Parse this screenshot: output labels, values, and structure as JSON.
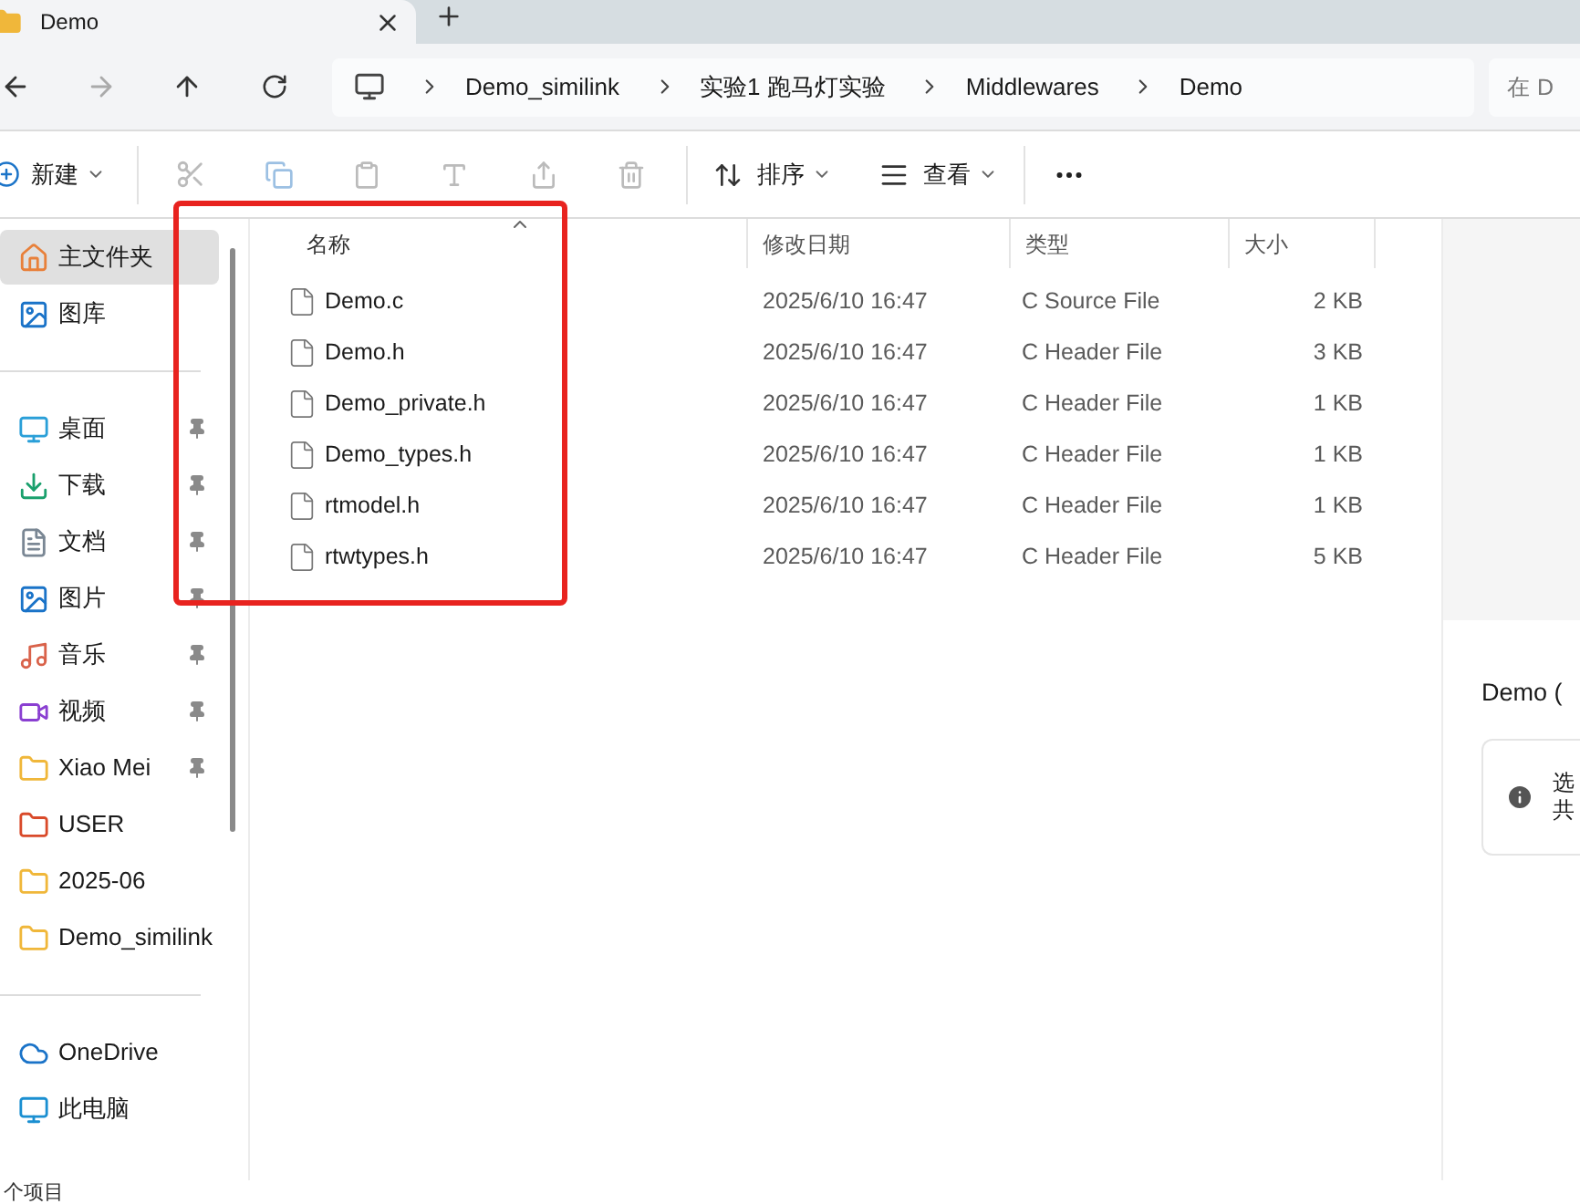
{
  "tab": {
    "title": "Demo"
  },
  "address": {
    "segments": [
      "Demo_similink",
      "实验1 跑马灯实验",
      "Middlewares",
      "Demo"
    ],
    "search_placeholder": "在 D"
  },
  "toolbar": {
    "new": "新建",
    "sort": "排序",
    "view": "查看"
  },
  "sidebar": {
    "groups": [
      {
        "items": [
          {
            "label": "主文件夹",
            "kind": "home",
            "pinned": false,
            "selected": true
          },
          {
            "label": "图库",
            "kind": "gallery",
            "pinned": false,
            "selected": false
          }
        ]
      },
      {
        "items": [
          {
            "label": "桌面",
            "kind": "desktop",
            "pinned": true,
            "selected": false
          },
          {
            "label": "下载",
            "kind": "download",
            "pinned": true,
            "selected": false
          },
          {
            "label": "文档",
            "kind": "document",
            "pinned": true,
            "selected": false
          },
          {
            "label": "图片",
            "kind": "picture",
            "pinned": true,
            "selected": false
          },
          {
            "label": "音乐",
            "kind": "music",
            "pinned": true,
            "selected": false
          },
          {
            "label": "视频",
            "kind": "video",
            "pinned": true,
            "selected": false
          },
          {
            "label": "Xiao Mei",
            "kind": "folder",
            "pinned": true,
            "selected": false
          },
          {
            "label": "USER",
            "kind": "folder-alert",
            "pinned": false,
            "selected": false
          },
          {
            "label": "2025-06",
            "kind": "folder",
            "pinned": false,
            "selected": false
          },
          {
            "label": "Demo_similink",
            "kind": "folder",
            "pinned": false,
            "selected": false
          }
        ]
      },
      {
        "items": [
          {
            "label": "OneDrive",
            "kind": "cloud",
            "pinned": false,
            "selected": false
          },
          {
            "label": "此电脑",
            "kind": "pc",
            "pinned": false,
            "selected": false
          }
        ]
      }
    ]
  },
  "table": {
    "columns": [
      {
        "label": "名称",
        "sorted": true
      },
      {
        "label": "修改日期",
        "sorted": false
      },
      {
        "label": "类型",
        "sorted": false
      },
      {
        "label": "大小",
        "sorted": false
      }
    ],
    "rows": [
      {
        "name": "Demo.c",
        "modified": "2025/6/10 16:47",
        "type": "C Source File",
        "size": "2 KB"
      },
      {
        "name": "Demo.h",
        "modified": "2025/6/10 16:47",
        "type": "C Header File",
        "size": "3 KB"
      },
      {
        "name": "Demo_private.h",
        "modified": "2025/6/10 16:47",
        "type": "C Header File",
        "size": "1 KB"
      },
      {
        "name": "Demo_types.h",
        "modified": "2025/6/10 16:47",
        "type": "C Header File",
        "size": "1 KB"
      },
      {
        "name": "rtmodel.h",
        "modified": "2025/6/10 16:47",
        "type": "C Header File",
        "size": "1 KB"
      },
      {
        "name": "rtwtypes.h",
        "modified": "2025/6/10 16:47",
        "type": "C Header File",
        "size": "5 KB"
      }
    ]
  },
  "details": {
    "title": "Demo (",
    "info_lines": [
      "选",
      "共"
    ]
  },
  "status_bar": "个项目"
}
